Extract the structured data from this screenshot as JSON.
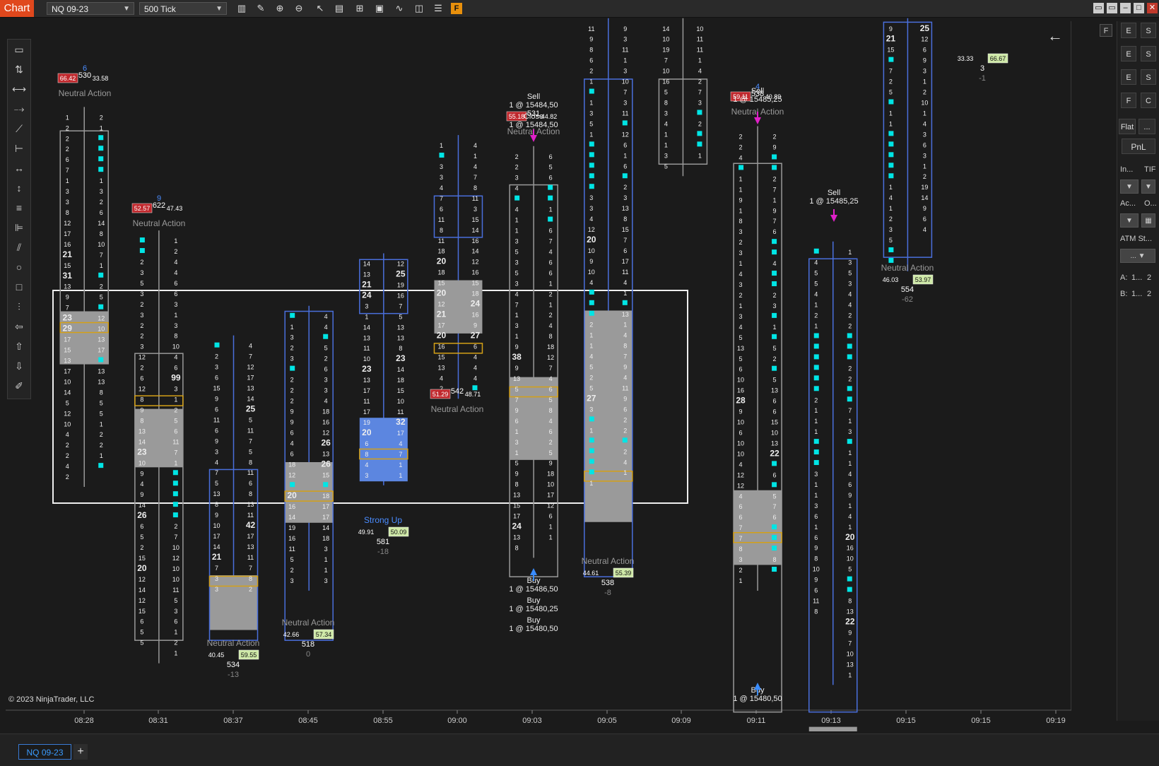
{
  "toolbar": {
    "chart_tab": "Chart",
    "instrument": "NQ 09-23",
    "interval": "500 Tick",
    "f_badge": "F"
  },
  "right_panel": {
    "buttons": [
      "E",
      "E",
      "E",
      "F"
    ],
    "side_buttons": [
      "S",
      "S",
      "S",
      "C"
    ],
    "flat": "Flat",
    "more": "...",
    "pnl": "PnL",
    "in_label": "In...",
    "tif_label": "TIF",
    "ac_label": "Ac...",
    "o_label": "O...",
    "atm_label": "ATM St...",
    "atm_value": "...",
    "a_label": "A:",
    "a_val": "1...",
    "a_num": "2",
    "b_label": "B:",
    "b_val": "1...",
    "b_num": "2"
  },
  "copyright": "© 2023 NinjaTrader, LLC",
  "bottom": {
    "tab": "NQ 09-23",
    "add": "+"
  },
  "chart_data": {
    "type": "footprint",
    "y_ticks": [
      "15491,00",
      "15490,00",
      "15489,00",
      "15488,00",
      "15487,00",
      "15486,00",
      "15485,00",
      "15484,00",
      "15483,00",
      "15482,00",
      "15481,00",
      "15480,00",
      "15479,00",
      "15478,00",
      "15477,00",
      "15476,00"
    ],
    "x_ticks": [
      "08:28",
      "08:31",
      "08:37",
      "08:45",
      "08:55",
      "09:00",
      "09:03",
      "09:05",
      "09:09",
      "09:11",
      "09:13",
      "09:15",
      "09:15",
      "09:19"
    ],
    "stats": [
      {
        "label": "Neutral Action",
        "num": "6",
        "vol": "530",
        "red": "66.42",
        "right": "33.58"
      },
      {
        "label": "Neutral Action",
        "num": "9",
        "vol": "622",
        "red": "52.57",
        "right": "47.43"
      },
      {
        "label": "Neutral Action",
        "left": "40.45",
        "green": "59.55",
        "vol": "534",
        "delta": "-13"
      },
      {
        "label": "Neutral Action",
        "left": "42.66",
        "green": "57.34",
        "vol": "518",
        "delta": "0"
      },
      {
        "label": "Strong Up",
        "left": "49.91",
        "green": "50.09",
        "vol": "581",
        "delta": "-18"
      },
      {
        "label": "Neutral Action",
        "red": "51.29",
        "right": "48.71",
        "vol": "542",
        "delta": "-42"
      },
      {
        "label": "Neutral Action",
        "red": "55.18",
        "right": "44.82",
        "vol": "531"
      },
      {
        "label": "Neutral Action",
        "left": "44.61",
        "green": "55.39",
        "vol": "538",
        "delta": "-8"
      },
      {
        "label": "Neutral Action",
        "num": "4",
        "red": "59.11",
        "right": "40.89",
        "vol": "538"
      },
      {
        "label": "Neutral Action",
        "left": "46.03",
        "green": "53.97",
        "vol": "554",
        "delta": "-62"
      },
      {
        "left": "33.33",
        "green": "66.67",
        "vol": "3",
        "delta": "-1"
      }
    ],
    "executions": [
      {
        "side": "Sell",
        "price": "1 @ 15484,50"
      },
      {
        "side": "Close",
        "price": "1 @ 15484,50"
      },
      {
        "side": "Buy",
        "price": "1 @ 15486,50"
      },
      {
        "side": "Buy",
        "price": "1 @ 15480,25"
      },
      {
        "side": "Buy",
        "price": "1 @ 15480,50"
      },
      {
        "side": "Sell",
        "price": "1 @ 15485,25"
      },
      {
        "side": "Buy",
        "price": "1 @ 15480,50"
      },
      {
        "side": "Sell",
        "price": "1 @ 15485,25"
      }
    ],
    "bars": [
      {
        "x": 114,
        "top": 158,
        "bid": [
          "1",
          "2",
          "2",
          "2",
          "6",
          "7",
          "1",
          "3",
          "3",
          "8",
          "12",
          "17",
          "16",
          "21",
          "15",
          "31",
          "13",
          "9",
          "7",
          "23",
          "29",
          "17",
          "15",
          "13",
          "17",
          "10",
          "14",
          "5",
          "12",
          "10",
          "4",
          "2",
          "2",
          "4",
          "2"
        ],
        "ask": [
          "2",
          "1",
          "■",
          "■",
          "■",
          "■",
          "1",
          "3",
          "2",
          "6",
          "14",
          "8",
          "10",
          "7",
          "1",
          "■",
          "2",
          "5",
          "■",
          "12",
          "10",
          "13",
          "17",
          "■",
          "13",
          "13",
          "8",
          "5",
          "5",
          "1",
          "2",
          "2",
          "1",
          "■"
        ],
        "boxTop": 177,
        "boxBot": 492,
        "greyTop": 421,
        "greyBot": 492,
        "poc": 443
      },
      {
        "x": 215,
        "top": 325,
        "bid": [
          "■",
          "■",
          "2",
          "3",
          "5",
          "3",
          "2",
          "3",
          "2",
          "2",
          "3",
          "12",
          "2",
          "6",
          "12",
          "8",
          "9",
          "8",
          "13",
          "14",
          "23",
          "10",
          "9",
          "4",
          "9",
          "14",
          "26",
          "6",
          "5",
          "2",
          "15",
          "20",
          "12",
          "14",
          "12",
          "15",
          "6",
          "5",
          "5"
        ],
        "ask": [
          "1",
          "2",
          "4",
          "4",
          "6",
          "6",
          "3",
          "1",
          "3",
          "8",
          "10",
          "4",
          "6",
          "99",
          "3",
          "1",
          "2",
          "5",
          "6",
          "11",
          "7",
          "1",
          "■",
          "■",
          "■",
          "■",
          "■",
          "2",
          "7",
          "10",
          "12",
          "10",
          "10",
          "11",
          "5",
          "3",
          "6",
          "1",
          "2",
          "1"
        ],
        "boxTop": 478,
        "boxBot": 866,
        "greyTop": 553,
        "greyBot": 632,
        "poc": 542
      },
      {
        "x": 316,
        "top": 467,
        "bid": [
          "■",
          "2",
          "3",
          "6",
          "15",
          "9",
          "6",
          "11",
          "6",
          "9",
          "3",
          "4",
          "7",
          "5",
          "13",
          "8",
          "9",
          "10",
          "17",
          "14",
          "21",
          "7",
          "3",
          "3"
        ],
        "ask": [
          "4",
          "7",
          "12",
          "17",
          "13",
          "14",
          "25",
          "5",
          "11",
          "7",
          "5",
          "8",
          "11",
          "6",
          "8",
          "13",
          "11",
          "42",
          "17",
          "13",
          "11",
          "7",
          "8",
          "2"
        ],
        "boxTop": 635,
        "boxBot": 866,
        "greyTop": 778,
        "greyBot": 852,
        "poc": 786
      },
      {
        "x": 418,
        "top": 427,
        "bid": [
          "■",
          "1",
          "3",
          "2",
          "3",
          "■",
          "2",
          "2",
          "2",
          "9",
          "9",
          "6",
          "4",
          "6",
          "18",
          "12",
          "■",
          "20",
          "16",
          "14",
          "19",
          "16",
          "11",
          "5",
          "2",
          "3"
        ],
        "ask": [
          "4",
          "4",
          "■",
          "5",
          "2",
          "6",
          "3",
          "3",
          "4",
          "18",
          "16",
          "12",
          "26",
          "13",
          "26",
          "15",
          "■",
          "18",
          "17",
          "17",
          "14",
          "18",
          "3",
          "1",
          "1",
          "3"
        ],
        "boxTop": 421,
        "boxBot": 866,
        "greyTop": 625,
        "greyBot": 707,
        "poc": 671
      },
      {
        "x": 519,
        "top": 356,
        "bid": [
          "14",
          "13",
          "21",
          "24",
          "3",
          "1",
          "14",
          "13",
          "11",
          "10",
          "23",
          "13",
          "17",
          "11",
          "17",
          "19",
          "20",
          "6",
          "8",
          "4",
          "3"
        ],
        "ask": [
          "12",
          "25",
          "19",
          "16",
          "7",
          "5",
          "13",
          "13",
          "8",
          "23",
          "14",
          "18",
          "15",
          "10",
          "11",
          "32",
          "17",
          "4",
          "7",
          "1",
          "1"
        ],
        "boxTop": 351,
        "boxBot": 424,
        "blueTop": 565,
        "blueBot": 651,
        "poc": 614
      },
      {
        "x": 620,
        "top": 196,
        "bid": [
          "1",
          "■",
          "3",
          "3",
          "4",
          "7",
          "6",
          "11",
          "8",
          "11",
          "18",
          "20",
          "18",
          "15",
          "20",
          "12",
          "21",
          "17",
          "20",
          "16",
          "15",
          "13",
          "4",
          "2"
        ],
        "ask": [
          "4",
          "1",
          "4",
          "7",
          "8",
          "11",
          "3",
          "15",
          "14",
          "16",
          "14",
          "12",
          "16",
          "15",
          "18",
          "24",
          "16",
          "9",
          "27",
          "6",
          "4",
          "4",
          "4",
          "■"
        ],
        "boxTop": 265,
        "boxBot": 321,
        "greyTop": 379,
        "greyBot": 451,
        "poc": 471
      },
      {
        "x": 722,
        "top": 211,
        "bid": [
          "2",
          "2",
          "3",
          "4",
          "■",
          "4",
          "1",
          "1",
          "3",
          "5",
          "3",
          "5",
          "3",
          "4",
          "7",
          "1",
          "3",
          "1",
          "9",
          "38",
          "9",
          "13",
          "5",
          "7",
          "9",
          "6",
          "1",
          "3",
          "1",
          "5",
          "9",
          "8",
          "13",
          "15",
          "17",
          "24",
          "13",
          "8"
        ],
        "ask": [
          "6",
          "5",
          "6",
          "■",
          "■",
          "1",
          "■",
          "6",
          "7",
          "4",
          "6",
          "6",
          "1",
          "2",
          "1",
          "2",
          "4",
          "8",
          "18",
          "12",
          "7",
          "4",
          "6",
          "5",
          "8",
          "4",
          "6",
          "2",
          "5",
          "9",
          "18",
          "10",
          "17",
          "12",
          "6",
          "1",
          "1"
        ],
        "boxTop": 250,
        "boxBot": 780,
        "greyTop": 510,
        "greyBot": 622,
        "poc": 530
      },
      {
        "x": 823,
        "top": 38,
        "bid": [
          "11",
          "9",
          "8",
          "6",
          "2",
          "1",
          "■",
          "1",
          "3",
          "5",
          "1",
          "■",
          "■",
          "■",
          "■",
          "■",
          "3",
          "3",
          "4",
          "12",
          "20",
          "10",
          "9",
          "10",
          "4",
          "■",
          "■",
          "■",
          "2",
          "1",
          "1",
          "4",
          "5",
          "2",
          "5",
          "27",
          "3",
          "■",
          "1",
          "■",
          "■",
          "■",
          "■",
          "1"
        ],
        "ask": [
          "9",
          "3",
          "11",
          "1",
          "3",
          "10",
          "7",
          "3",
          "11",
          "■",
          "12",
          "6",
          "1",
          "6",
          "■",
          "2",
          "3",
          "13",
          "8",
          "15",
          "7",
          "6",
          "17",
          "11",
          "4",
          "1",
          "■",
          "13",
          "1",
          "4",
          "8",
          "7",
          "9",
          "4",
          "11",
          "9",
          "6",
          "2",
          "2",
          "■",
          "2",
          "4",
          "1"
        ],
        "boxTop": 107,
        "boxBot": 780,
        "greyTop": 420,
        "greyBot": 706,
        "poc": 644
      },
      {
        "x": 924,
        "top": 38,
        "bid": [
          "14",
          "10",
          "19",
          "7",
          "10",
          "16",
          "5",
          "8",
          "3",
          "4",
          "1",
          "1",
          "3",
          "5"
        ],
        "ask": [
          "10",
          "11",
          "11",
          "1",
          "4",
          "2",
          "7",
          "3",
          "■",
          "2",
          "■",
          "■",
          "1"
        ],
        "boxTop": 107,
        "boxBot": 222,
        "poc": 0
      },
      {
        "x": 1025,
        "top": 184,
        "bid": [
          "2",
          "2",
          "4",
          "■",
          "1",
          "1",
          "9",
          "1",
          "8",
          "3",
          "2",
          "3",
          "1",
          "4",
          "3",
          "2",
          "1",
          "3",
          "4",
          "5",
          "13",
          "5",
          "6",
          "10",
          "16",
          "28",
          "9",
          "10",
          "6",
          "10",
          "10",
          "4",
          "12",
          "12",
          "4",
          "6",
          "6",
          "7",
          "7",
          "8",
          "3",
          "2",
          "1"
        ],
        "ask": [
          "2",
          "9",
          "■",
          "■",
          "2",
          "7",
          "1",
          "9",
          "7",
          "6",
          "■",
          "■",
          "4",
          "■",
          "■",
          "2",
          "3",
          "■",
          "1",
          "■",
          "5",
          "2",
          "■",
          "5",
          "13",
          "6",
          "6",
          "15",
          "10",
          "13",
          "22",
          "■",
          "6",
          "■",
          "5",
          "7",
          "6",
          "■",
          "■",
          "■",
          "8",
          "■"
        ],
        "boxTop": 221,
        "boxBot": 963,
        "greyTop": 663,
        "greyBot": 764,
        "poc": 727
      },
      {
        "x": 1127,
        "top": 340,
        "bid": [
          "■",
          "4",
          "5",
          "5",
          "4",
          "1",
          "2",
          "1",
          "■",
          "■",
          "■",
          "■",
          "■",
          "■",
          "2",
          "1",
          "1",
          "1",
          "■",
          "■",
          "■",
          "3",
          "1",
          "1",
          "3",
          "6",
          "1",
          "6",
          "9",
          "8",
          "10",
          "9",
          "6",
          "11",
          "8"
        ],
        "ask": [
          "1",
          "3",
          "5",
          "3",
          "4",
          "4",
          "2",
          "2",
          "■",
          "■",
          "■",
          "2",
          "2",
          "■",
          "■",
          "7",
          "1",
          "3",
          "■",
          "1",
          "1",
          "4",
          "6",
          "9",
          "1",
          "4",
          "1",
          "20",
          "16",
          "10",
          "5",
          "■",
          "■",
          "8",
          "13",
          "22",
          "9",
          "7",
          "10",
          "13",
          "1"
        ],
        "boxTop": 350,
        "boxBot": 963,
        "greyTop": 983,
        "greyBot": 1005,
        "poc": 0
      },
      {
        "x": 1228,
        "top": 38,
        "bid": [
          "9",
          "21",
          "15",
          "■",
          "7",
          "2",
          "5",
          "■",
          "1",
          "1",
          "■",
          "■",
          "■",
          "■",
          "■",
          "1",
          "4",
          "1",
          "2",
          "3",
          "5",
          "■",
          "■"
        ],
        "ask": [
          "25",
          "12",
          "6",
          "9",
          "3",
          "1",
          "2",
          "10",
          "1",
          "4",
          "3",
          "6",
          "3",
          "1",
          "2",
          "19",
          "14",
          "9",
          "6",
          "4"
        ],
        "boxTop": 30,
        "boxBot": 348,
        "poc": 0
      }
    ]
  }
}
